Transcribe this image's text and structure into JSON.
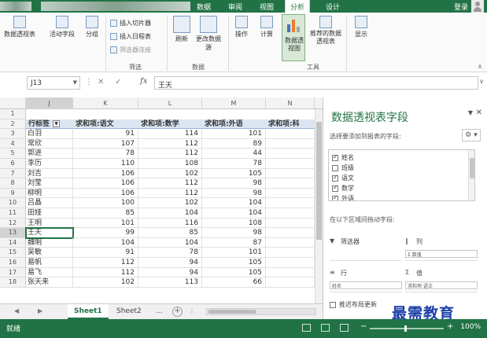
{
  "titlebar": {
    "tabs": [
      "数据",
      "审阅",
      "视图",
      "分析",
      "设计"
    ],
    "active_tab": "分析",
    "login": "登录"
  },
  "ribbon": {
    "pivottable": "数据透视表",
    "active_field": "活动字段",
    "group": "分组",
    "insert_slicer": "插入切片器",
    "insert_timeline": "插入日程表",
    "filter_connections": "筛选器连接",
    "filter_group": "筛选",
    "refresh": "刷新",
    "change_source": "更改数据源",
    "data_group": "数据",
    "actions": "操作",
    "calculations": "计算",
    "pivotchart": "数据透视图",
    "recommended": "推荐的数据透视表",
    "tools_group": "工具",
    "show": "显示"
  },
  "formula_bar": {
    "name_box": "J13",
    "fx": "fx",
    "value": "王天"
  },
  "grid": {
    "columns": [
      "J",
      "K",
      "L",
      "M",
      "N"
    ],
    "headers": [
      "行标签",
      "求和项:语文",
      "求和项:数学",
      "求和项:外语",
      "求和项:科"
    ],
    "rows": [
      {
        "num": "3",
        "name": "白羽",
        "yuwen": "91",
        "shuxue": "114",
        "waiyu": "101"
      },
      {
        "num": "4",
        "name": "常欣",
        "yuwen": "107",
        "shuxue": "112",
        "waiyu": "89"
      },
      {
        "num": "5",
        "name": "郭进",
        "yuwen": "78",
        "shuxue": "112",
        "waiyu": "44"
      },
      {
        "num": "6",
        "name": "李历",
        "yuwen": "110",
        "shuxue": "108",
        "waiyu": "78"
      },
      {
        "num": "7",
        "name": "刘吉",
        "yuwen": "106",
        "shuxue": "102",
        "waiyu": "105"
      },
      {
        "num": "8",
        "name": "刘莹",
        "yuwen": "106",
        "shuxue": "112",
        "waiyu": "98"
      },
      {
        "num": "9",
        "name": "柳明",
        "yuwen": "106",
        "shuxue": "112",
        "waiyu": "98"
      },
      {
        "num": "10",
        "name": "吕晶",
        "yuwen": "100",
        "shuxue": "102",
        "waiyu": "104"
      },
      {
        "num": "11",
        "name": "田娅",
        "yuwen": "85",
        "shuxue": "104",
        "waiyu": "104"
      },
      {
        "num": "12",
        "name": "王明",
        "yuwen": "101",
        "shuxue": "116",
        "waiyu": "108"
      },
      {
        "num": "13",
        "name": "王天",
        "yuwen": "99",
        "shuxue": "85",
        "waiyu": "98"
      },
      {
        "num": "14",
        "name": "魏明",
        "yuwen": "104",
        "shuxue": "104",
        "waiyu": "87"
      },
      {
        "num": "15",
        "name": "吴敏",
        "yuwen": "91",
        "shuxue": "78",
        "waiyu": "101"
      },
      {
        "num": "16",
        "name": "易帆",
        "yuwen": "112",
        "shuxue": "94",
        "waiyu": "105"
      },
      {
        "num": "17",
        "name": "易飞",
        "yuwen": "112",
        "shuxue": "94",
        "waiyu": "105"
      },
      {
        "num": "18",
        "name": "张天来",
        "yuwen": "102",
        "shuxue": "113",
        "waiyu": "66"
      }
    ],
    "header_row_num": "2",
    "first_row_num": "1"
  },
  "sheets": {
    "tabs": [
      "Sheet1",
      "Sheet2"
    ],
    "active": "Sheet1",
    "more": "..."
  },
  "pane": {
    "title": "数据透视表字段",
    "hint": "选择要添加到报表的字段:",
    "fields": [
      {
        "label": "姓名",
        "checked": true
      },
      {
        "label": "班级",
        "checked": false
      },
      {
        "label": "语文",
        "checked": true
      },
      {
        "label": "数学",
        "checked": true
      },
      {
        "label": "外语",
        "checked": true
      }
    ],
    "drag_hint": "在以下区域间拖动字段:",
    "zones": {
      "filters": "筛选器",
      "columns": "列",
      "rows": "行",
      "values": "值",
      "columns_item": "Σ 数值",
      "rows_item": "姓名",
      "values_item": "求和项:语文"
    },
    "defer": "推迟布局更新"
  },
  "status": {
    "ready": "就绪",
    "zoom": "100%"
  },
  "watermark": "最需教育"
}
